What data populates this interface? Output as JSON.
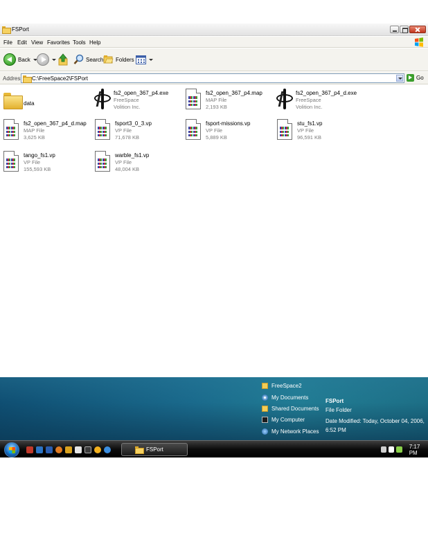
{
  "window": {
    "title": "FSPort"
  },
  "menu": [
    "File",
    "Edit",
    "View",
    "Favorites",
    "Tools",
    "Help"
  ],
  "toolbar": {
    "back_label": "Back",
    "search_label": "Search",
    "folders_label": "Folders"
  },
  "address": {
    "label": "Address",
    "value": "C:\\FreeSpace2\\FSPort",
    "go_label": "Go"
  },
  "files": [
    {
      "name": "data",
      "type": "",
      "size": "",
      "icon": "folder-icon"
    },
    {
      "name": "fs2_open_367_p4.exe",
      "type": "FreeSpace",
      "size": "Volition Inc.",
      "icon": "freespace-exe-icon"
    },
    {
      "name": "fs2_open_367_p4.map",
      "type": "MAP File",
      "size": "2,193 KB",
      "icon": "map-file-icon"
    },
    {
      "name": "fs2_open_367_p4_d.exe",
      "type": "FreeSpace",
      "size": "Volition Inc.",
      "icon": "freespace-exe-icon"
    },
    {
      "name": "fs2_open_367_p4_d.map",
      "type": "MAP File",
      "size": "3,625 KB",
      "icon": "map-file-icon"
    },
    {
      "name": "fsport3_0_3.vp",
      "type": "VP File",
      "size": "71,678 KB",
      "icon": "vp-file-icon"
    },
    {
      "name": "fsport-missions.vp",
      "type": "VP File",
      "size": "5,889 KB",
      "icon": "vp-file-icon"
    },
    {
      "name": "stu_fs1.vp",
      "type": "VP File",
      "size": "96,591 KB",
      "icon": "vp-file-icon"
    },
    {
      "name": "tango_fs1.vp",
      "type": "VP File",
      "size": "155,593 KB",
      "icon": "vp-file-icon"
    },
    {
      "name": "warble_fs1.vp",
      "type": "VP File",
      "size": "48,004 KB",
      "icon": "vp-file-icon"
    }
  ],
  "start_panel": {
    "places": [
      "FreeSpace2",
      "My Documents",
      "Shared Documents",
      "My Computer",
      "My Network Places"
    ],
    "selected_name": "FSPort",
    "selected_type": "File Folder",
    "selected_modified": "Date Modified: Today, October 04, 2006, 6:52 PM"
  },
  "taskbar": {
    "task_label": "FSPort",
    "clock": "7:17 PM"
  },
  "colors": {
    "title_bar": "#e2e2e2",
    "close_button": "#c2351b",
    "start_panel": "#1a6a8c",
    "taskbar": "#0c0c0c"
  }
}
